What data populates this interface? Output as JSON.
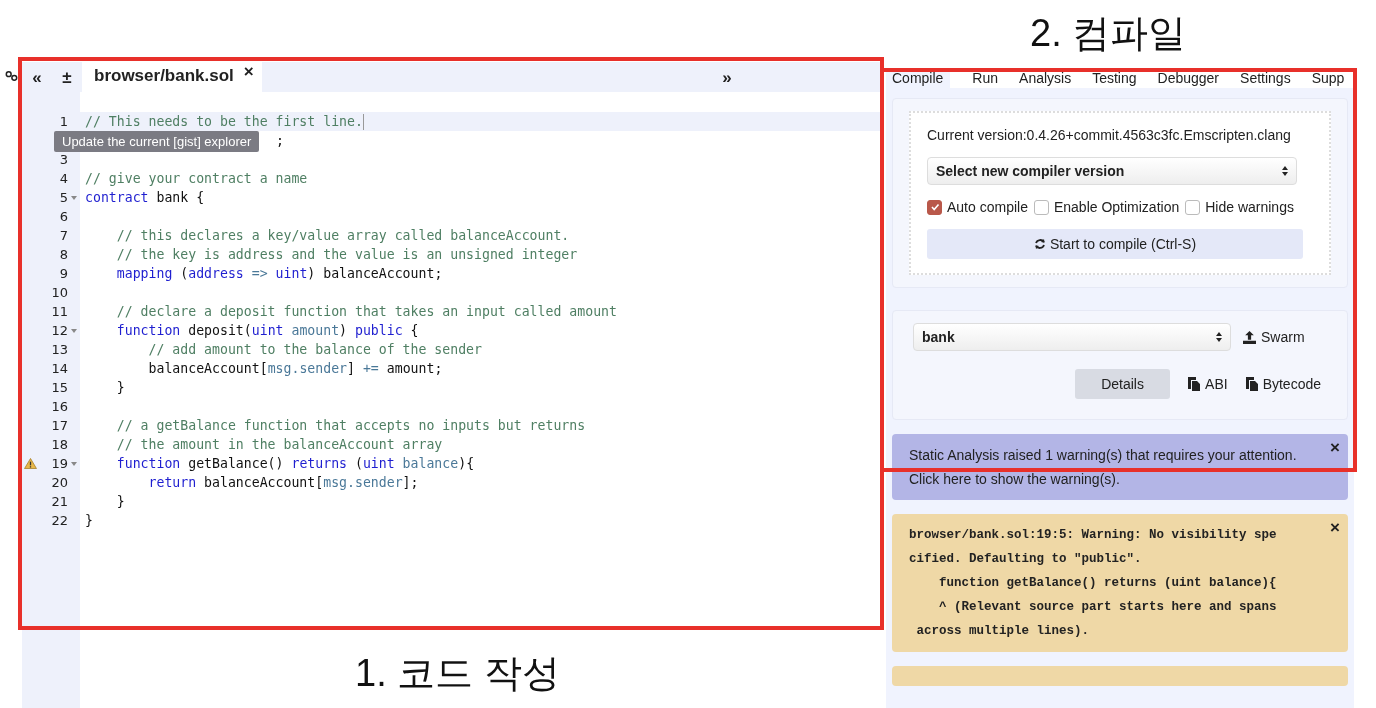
{
  "annotations": [
    {
      "label": "2. 컴파일"
    },
    {
      "label": "1. 코드 작성"
    }
  ],
  "editor": {
    "collapse_icon": "«",
    "add_icon": "±",
    "expand_icon": "»",
    "close_icon": "×",
    "tabs": [
      {
        "label": "browser/bank.sol",
        "selected": true
      }
    ],
    "tooltip": "Update the current [gist] explorer",
    "lines": [
      {
        "number": "1",
        "current": true,
        "tokens": [
          {
            "kind": "comment",
            "text": "// This needs to be the first line."
          }
        ]
      },
      {
        "kind": "covered",
        "tokens": [
          {
            "kind": "plain",
            "text": ";"
          }
        ]
      },
      {
        "number": "3",
        "current": false
      },
      {
        "number": "4",
        "current": false,
        "tokens": [
          {
            "kind": "comment",
            "text": "// give your contract a name"
          }
        ]
      },
      {
        "number": "5",
        "current": false,
        "foldable": true,
        "tokens": [
          {
            "kind": "keyword",
            "text": "contract"
          },
          {
            "kind": "plain",
            "text": " bank {"
          }
        ]
      },
      {
        "number": "6",
        "current": false
      },
      {
        "number": "7",
        "current": false,
        "tokens": [
          {
            "kind": "comment",
            "text": "    // this declares a key/value array called balanceAccount."
          }
        ]
      },
      {
        "number": "8",
        "current": false,
        "tokens": [
          {
            "kind": "comment",
            "text": "    // the key is address and the value is an unsigned integer"
          }
        ]
      },
      {
        "number": "9",
        "current": false,
        "tokens": [
          {
            "kind": "keyword",
            "text": "    mapping"
          },
          {
            "kind": "plain",
            "text": " ("
          },
          {
            "kind": "keyword",
            "text": "address"
          },
          {
            "kind": "member",
            "text": " => "
          },
          {
            "kind": "keyword",
            "text": "uint"
          },
          {
            "kind": "plain",
            "text": ") balanceAccount;"
          }
        ]
      },
      {
        "number": "10",
        "current": false
      },
      {
        "number": "11",
        "current": false,
        "tokens": [
          {
            "kind": "comment",
            "text": "    // declare a deposit function that takes an input called amount"
          }
        ]
      },
      {
        "number": "12",
        "current": false,
        "foldable": true,
        "tokens": [
          {
            "kind": "keyword",
            "text": "    function"
          },
          {
            "kind": "plain",
            "text": " deposit("
          },
          {
            "kind": "keyword",
            "text": "uint"
          },
          {
            "kind": "member",
            "text": " amount"
          },
          {
            "kind": "plain",
            "text": ") "
          },
          {
            "kind": "keyword",
            "text": "public"
          },
          {
            "kind": "plain",
            "text": " {"
          }
        ]
      },
      {
        "number": "13",
        "current": false,
        "tokens": [
          {
            "kind": "comment",
            "text": "        // add amount to the balance of the sender"
          }
        ]
      },
      {
        "number": "14",
        "current": false,
        "tokens": [
          {
            "kind": "plain",
            "text": "        balanceAccount["
          },
          {
            "kind": "member",
            "text": "msg.sender"
          },
          {
            "kind": "plain",
            "text": "] "
          },
          {
            "kind": "member",
            "text": "+="
          },
          {
            "kind": "plain",
            "text": " amount;"
          }
        ]
      },
      {
        "number": "15",
        "current": false,
        "tokens": [
          {
            "kind": "plain",
            "text": "    }"
          }
        ]
      },
      {
        "number": "16",
        "current": false
      },
      {
        "number": "17",
        "current": false,
        "tokens": [
          {
            "kind": "comment",
            "text": "    // a getBalance function that accepts no inputs but returns"
          }
        ]
      },
      {
        "number": "18",
        "current": false,
        "tokens": [
          {
            "kind": "comment",
            "text": "    // the amount in the balanceAccount array"
          }
        ]
      },
      {
        "number": "19",
        "current": false,
        "foldable": true,
        "warning": true,
        "tokens": [
          {
            "kind": "keyword",
            "text": "    function"
          },
          {
            "kind": "plain",
            "text": " getBalance() "
          },
          {
            "kind": "keyword",
            "text": "returns"
          },
          {
            "kind": "plain",
            "text": " ("
          },
          {
            "kind": "keyword",
            "text": "uint"
          },
          {
            "kind": "member",
            "text": " balance"
          },
          {
            "kind": "plain",
            "text": "){"
          }
        ]
      },
      {
        "number": "20",
        "current": false,
        "tokens": [
          {
            "kind": "keyword",
            "text": "        return"
          },
          {
            "kind": "plain",
            "text": " balanceAccount["
          },
          {
            "kind": "member",
            "text": "msg.sender"
          },
          {
            "kind": "plain",
            "text": "];"
          }
        ]
      },
      {
        "number": "21",
        "current": false,
        "tokens": [
          {
            "kind": "plain",
            "text": "    }"
          }
        ]
      },
      {
        "number": "22",
        "current": false,
        "tokens": [
          {
            "kind": "plain",
            "text": "}"
          }
        ]
      }
    ]
  },
  "panel": {
    "tabs": [
      {
        "label": "Compile",
        "selected": true
      },
      {
        "label": "Run",
        "selected": false
      },
      {
        "label": "Analysis",
        "selected": false
      },
      {
        "label": "Testing",
        "selected": false
      },
      {
        "label": "Debugger",
        "selected": false
      },
      {
        "label": "Settings",
        "selected": false
      },
      {
        "label": "Supp",
        "selected": false
      }
    ],
    "version": "Current version:0.4.26+commit.4563c3fc.Emscripten.clang",
    "compiler_select": "Select new compiler version",
    "options": [
      {
        "label": "Auto compile",
        "checked": true
      },
      {
        "label": "Enable Optimization",
        "checked": false
      },
      {
        "label": "Hide warnings",
        "checked": false
      }
    ],
    "compile_button": "Start to compile (Ctrl-S)",
    "contract_select": "bank",
    "swarm": "Swarm",
    "details": "Details",
    "abi": "ABI",
    "bytecode": "Bytecode",
    "messages": [
      {
        "kind": "info",
        "text": "Static Analysis raised 1 warning(s) that requires your attention.\nClick here to show the warning(s)."
      },
      {
        "kind": "warning",
        "text": "browser/bank.sol:19:5: Warning: No visibility spe\ncified. Defaulting to \"public\".\n    function getBalance() returns (uint balance){\n    ^ (Relevant source part starts here and spans\n across multiple lines)."
      }
    ],
    "close_icon": "×"
  }
}
